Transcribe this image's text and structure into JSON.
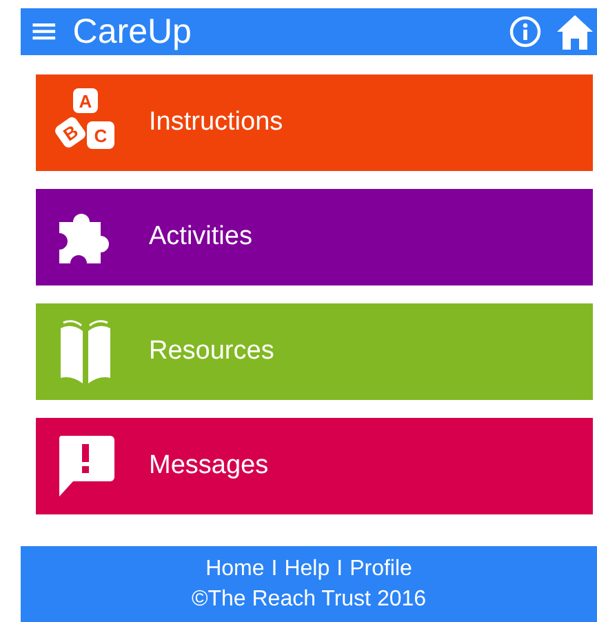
{
  "header": {
    "menu_glyph": "≡",
    "title": "CareUp"
  },
  "tiles": [
    {
      "kind": "blocks",
      "label": "Instructions",
      "color": "#f0430a",
      "letters": [
        "A",
        "B",
        "C"
      ]
    },
    {
      "kind": "puzzle",
      "label": "Activities",
      "color": "#800099"
    },
    {
      "kind": "book",
      "label": "Resources",
      "color": "#82b823"
    },
    {
      "kind": "speech",
      "label": "Messages",
      "color": "#d6004d"
    }
  ],
  "footer": {
    "links": [
      "Home",
      "Help",
      "Profile"
    ],
    "separators": [
      "I",
      "I"
    ],
    "copyright": "©The Reach Trust 2016"
  }
}
